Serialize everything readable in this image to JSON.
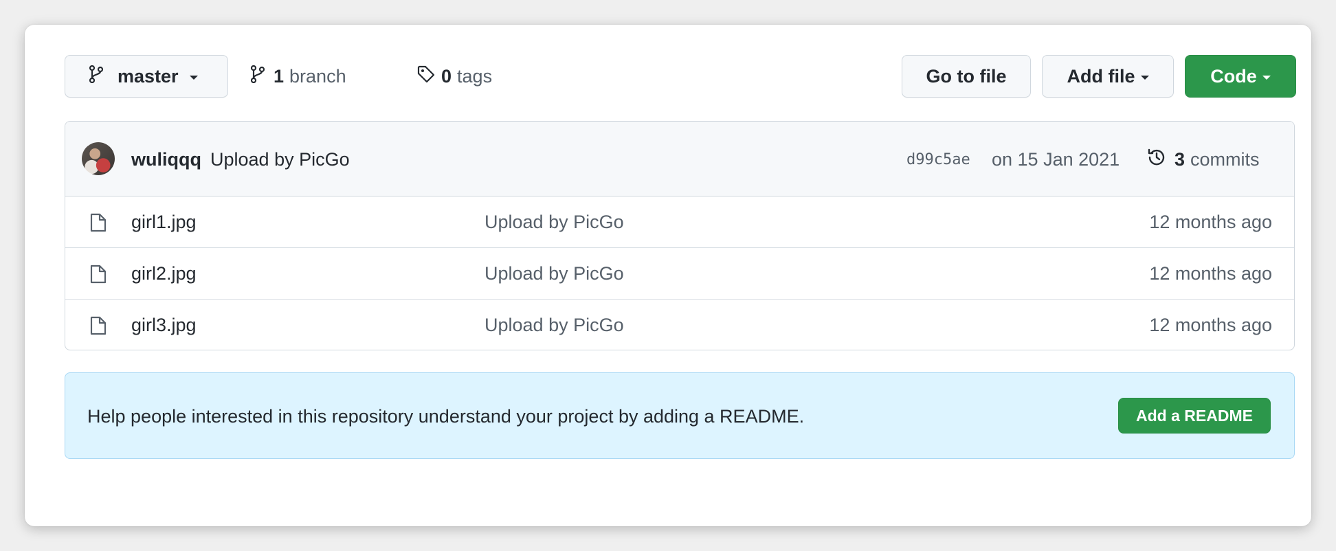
{
  "toolbar": {
    "branch_name": "master",
    "branch_count": "1",
    "branch_label": "branch",
    "tag_count": "0",
    "tag_label": "tags",
    "goto_file_label": "Go to file",
    "add_file_label": "Add file",
    "code_label": "Code"
  },
  "latest_commit": {
    "author": "wuliqqq",
    "message": "Upload by PicGo",
    "sha": "d99c5ae",
    "date": "on 15 Jan 2021",
    "commit_count": "3",
    "commit_label": "commits"
  },
  "files": [
    {
      "name": "girl1.jpg",
      "message": "Upload by PicGo",
      "age": "12 months ago"
    },
    {
      "name": "girl2.jpg",
      "message": "Upload by PicGo",
      "age": "12 months ago"
    },
    {
      "name": "girl3.jpg",
      "message": "Upload by PicGo",
      "age": "12 months ago"
    }
  ],
  "readme_banner": {
    "text": "Help people interested in this repository understand your project by adding a README.",
    "button_label": "Add a README"
  },
  "colors": {
    "primary_green": "#2c974b",
    "banner_blue": "#ddf4ff",
    "muted_text": "#57606a"
  },
  "icons": {
    "branch": "git-branch-icon",
    "tag": "tag-icon",
    "history": "history-icon",
    "file": "file-icon"
  }
}
